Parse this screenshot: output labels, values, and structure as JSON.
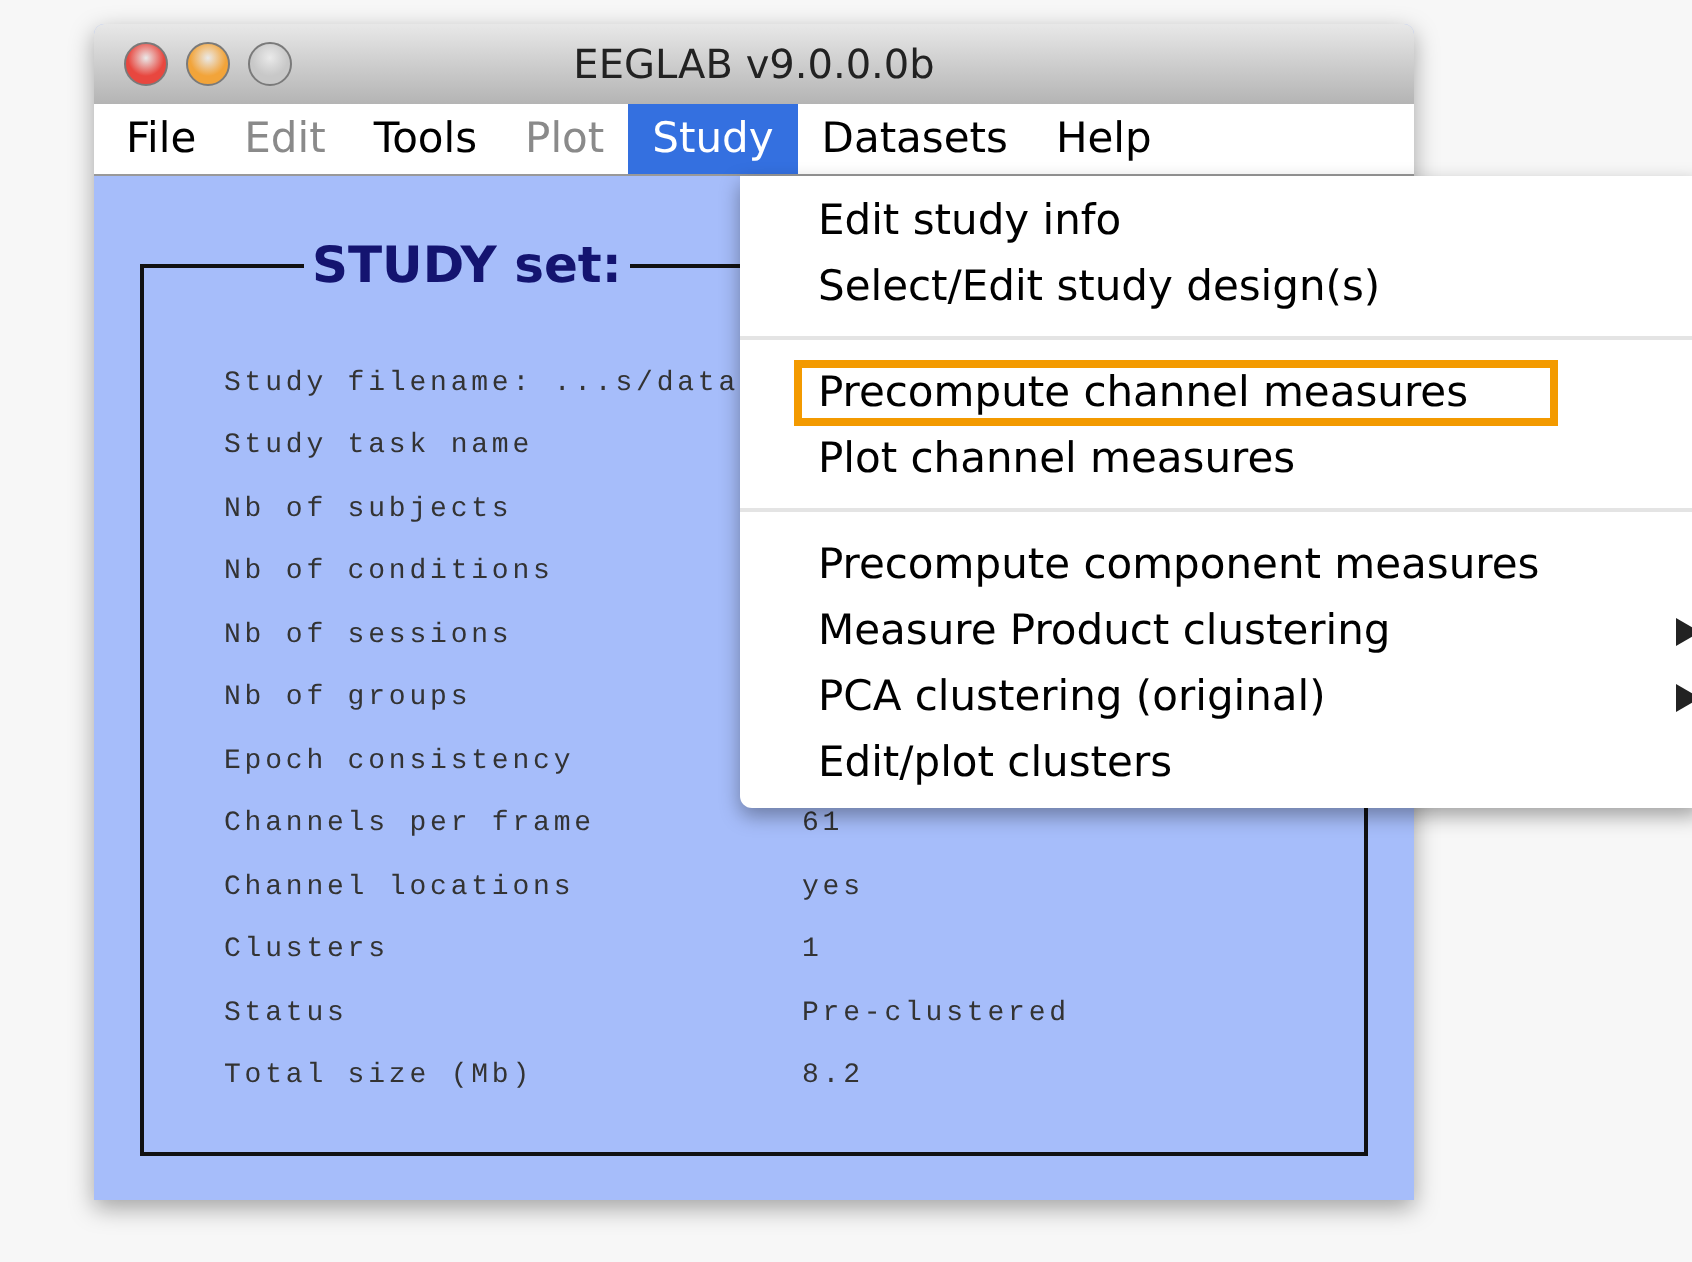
{
  "window": {
    "title": "EEGLAB v9.0.0.0b"
  },
  "menu_bar": [
    {
      "label": "File",
      "disabled": false,
      "selected": false
    },
    {
      "label": "Edit",
      "disabled": true,
      "selected": false
    },
    {
      "label": "Tools",
      "disabled": false,
      "selected": false
    },
    {
      "label": "Plot",
      "disabled": true,
      "selected": false
    },
    {
      "label": "Study",
      "disabled": false,
      "selected": true
    },
    {
      "label": "Datasets",
      "disabled": false,
      "selected": false
    },
    {
      "label": "Help",
      "disabled": false,
      "selected": false
    }
  ],
  "study_panel": {
    "title": "STUDY set:",
    "rows": [
      {
        "label": "Study filename: ...s/data"
      },
      {
        "label": "Study task name"
      },
      {
        "label": "Nb of subjects"
      },
      {
        "label": "Nb of conditions"
      },
      {
        "label": "Nb of sessions"
      },
      {
        "label": "Nb of groups"
      },
      {
        "label": "Epoch consistency"
      },
      {
        "label": "Channels per frame",
        "value": "61"
      },
      {
        "label": "Channel locations",
        "value": "yes"
      },
      {
        "label": "Clusters",
        "value": "1"
      },
      {
        "label": "Status",
        "value": "Pre-clustered"
      },
      {
        "label": "Total size (Mb)",
        "value": "8.2"
      }
    ]
  },
  "study_menu": {
    "sections": [
      [
        {
          "label": "Edit study info",
          "highlighted": false,
          "submenu": false
        },
        {
          "label": "Select/Edit study design(s)",
          "highlighted": false,
          "submenu": false
        }
      ],
      [
        {
          "label": "Precompute channel measures",
          "highlighted": true,
          "submenu": false
        },
        {
          "label": "Plot channel measures",
          "highlighted": false,
          "submenu": false
        }
      ],
      [
        {
          "label": "Precompute component measures",
          "highlighted": false,
          "submenu": false
        },
        {
          "label": "Measure Product clustering",
          "highlighted": false,
          "submenu": true
        },
        {
          "label": "PCA clustering (original)",
          "highlighted": false,
          "submenu": true
        },
        {
          "label": "Edit/plot clusters",
          "highlighted": false,
          "submenu": false
        }
      ]
    ]
  }
}
